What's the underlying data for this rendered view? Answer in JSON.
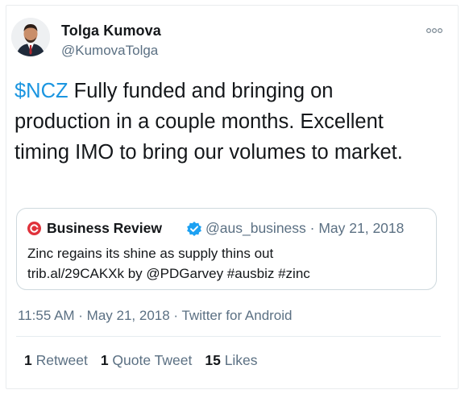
{
  "tweet": {
    "author_name": "Tolga Kumova",
    "author_handle": "@KumovaTolga",
    "cashtag": "$NCZ",
    "text_rest": " Fully funded and bringing on production in a couple months. Excellent timing IMO to bring our volumes to market.",
    "timestamp": "11:55 AM · May 21, 2018 · Twitter for Android",
    "icons": {
      "avatar": "author-avatar",
      "more": "more-options-icon"
    }
  },
  "quoted": {
    "name": "Business Review",
    "meta": "@aus_business · May 21, 2018",
    "line1": "Zinc regains its shine as supply thins out",
    "line2": "trib.al/29CAKXk by @PDGarvey #ausbiz #zinc",
    "icons": {
      "logo": "business-review-logo-icon",
      "verified": "verified-badge-icon"
    }
  },
  "stats": {
    "retweets_count": "1",
    "retweets_label": "Retweet",
    "quotes_count": "1",
    "quotes_label": "Quote Tweet",
    "likes_count": "15",
    "likes_label": "Likes"
  },
  "colors": {
    "link": "#1b95e0",
    "verified": "#1da1f2",
    "secondary_text": "#5b7083",
    "logo_red": "#e0323b"
  }
}
